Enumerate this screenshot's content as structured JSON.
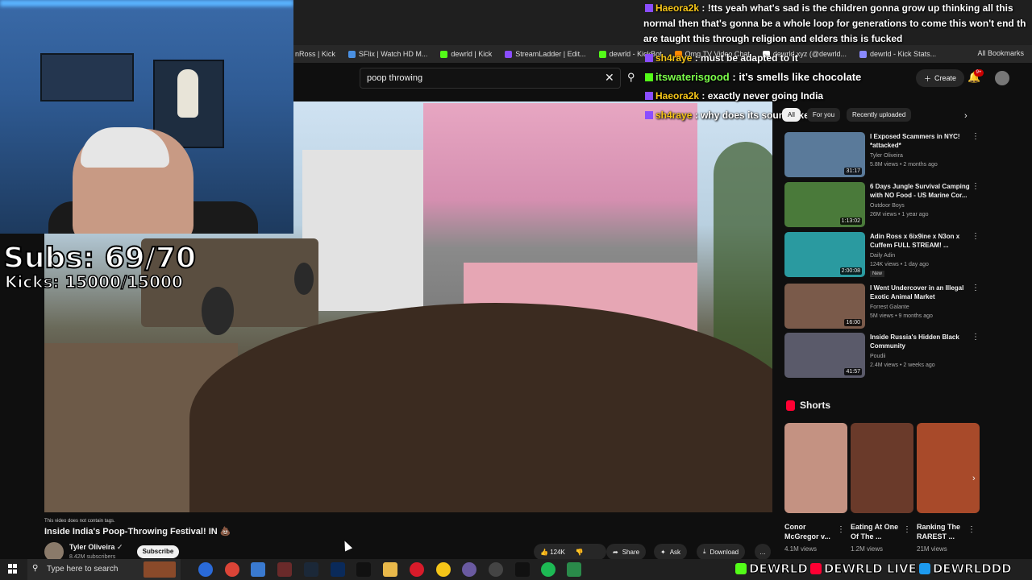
{
  "overlay": {
    "subs": "Subs: 69/70",
    "kicks": "Kicks: 15000/15000"
  },
  "chat": [
    {
      "user": "Haeora2k",
      "text": ": !tts yeah what's sad is the children gonna grow up thinking all this"
    },
    {
      "user": "",
      "text": "normal then that's gonna be a whole loop for generations to come this won't end th"
    },
    {
      "user": "",
      "text": "are taught this through religion and elders this is fucked"
    },
    {
      "user": "sh4raye",
      "text": ": must be adapted to it"
    },
    {
      "user": "itswaterisgood",
      "text": ": it's smells like chocolate"
    },
    {
      "user": "Haeora2k",
      "text": ": exactly never going India"
    },
    {
      "user": "sh4raye",
      "text": ": why does its sound like that"
    }
  ],
  "bookmarks": [
    {
      "label": "nRoss | Kick",
      "color": "#53fc18"
    },
    {
      "label": "SFlix | Watch HD M...",
      "color": "#4a90e2"
    },
    {
      "label": "dewrld | Kick",
      "color": "#53fc18"
    },
    {
      "label": "StreamLadder | Edit...",
      "color": "#8a4dff"
    },
    {
      "label": "dewrld - KickBot",
      "color": "#53fc18"
    },
    {
      "label": "Omg TV Video Chat",
      "color": "#ff8800"
    },
    {
      "label": "dewrld.xyz (@dewrld...",
      "color": "#ffffff"
    },
    {
      "label": "dewrld - Kick Stats...",
      "color": "#8a8aff"
    }
  ],
  "all_bookmarks": "All Bookmarks",
  "search": {
    "value": "poop throwing"
  },
  "header": {
    "create": "Create",
    "notif_count": "9+"
  },
  "video": {
    "no_tags": "This video does not contain tags.",
    "title": "Inside India's Poop-Throwing Festival! IN 💩",
    "channel": "Tyler Oliveira",
    "subscribers": "8.42M subscribers",
    "subscribe": "Subscribe",
    "likes": "124K",
    "share": "Share",
    "ask": "Ask",
    "download": "Download",
    "more": "…"
  },
  "chips": [
    "All",
    "For you",
    "Recently uploaded"
  ],
  "recommendations": [
    {
      "title": "I Exposed Scammers in NYC! *attacked*",
      "channel": "Tyler Oliveira",
      "meta": "5.8M views • 2 months ago",
      "duration": "31:17",
      "color": "#5a7a9a"
    },
    {
      "title": "6 Days Jungle Survival Camping with NO Food - US Marine Cor...",
      "channel": "Outdoor Boys",
      "meta": "26M views • 1 year ago",
      "duration": "1:13:02",
      "color": "#4a7a3a"
    },
    {
      "title": "Adin Ross x 6ix9ine x N3on x Cuffem FULL STREAM! ...",
      "channel": "Daily Adin",
      "meta": "124K views • 1 day ago",
      "duration": "2:00:08",
      "color": "#2a9aa0",
      "badge": "New"
    },
    {
      "title": "I Went Undercover in an Illegal Exotic Animal Market",
      "channel": "Forrest Galante",
      "meta": "5M views • 9 months ago",
      "duration": "16:00",
      "color": "#7a5a4a"
    },
    {
      "title": "Inside Russia's Hidden Black Community",
      "channel": "Poudii",
      "meta": "2.4M views • 2 weeks ago",
      "duration": "41:57",
      "color": "#5a5a6a"
    }
  ],
  "shorts": {
    "label": "Shorts",
    "items": [
      {
        "title": "Conor McGregor v...",
        "views": "4.1M views",
        "color": "#c49282"
      },
      {
        "title": "Eating At One Of The ...",
        "views": "1.2M views",
        "color": "#6a3a2a"
      },
      {
        "title": "Ranking The RAREST ...",
        "views": "21M views",
        "color": "#a84a2a"
      }
    ]
  },
  "taskbar": {
    "search": "Type here to search"
  },
  "social": [
    "DEWRLD",
    "DEWRLD LIVE",
    "DEWRLDDD"
  ]
}
